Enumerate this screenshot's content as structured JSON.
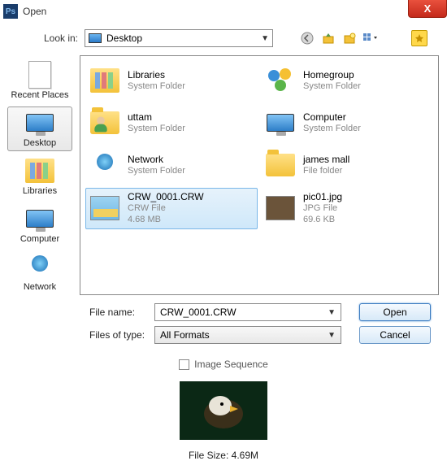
{
  "title": "Open",
  "close_label": "X",
  "lookin": {
    "label": "Look in:",
    "value": "Desktop"
  },
  "nav": {
    "back": "back-icon",
    "up": "up-icon",
    "newfolder": "new-folder-icon",
    "view": "view-menu-icon",
    "favorites": "favorites-icon"
  },
  "places": [
    {
      "label": "Recent Places",
      "icon": "recent-places-icon"
    },
    {
      "label": "Desktop",
      "icon": "desktop-icon",
      "selected": true
    },
    {
      "label": "Libraries",
      "icon": "libraries-icon"
    },
    {
      "label": "Computer",
      "icon": "computer-icon"
    },
    {
      "label": "Network",
      "icon": "network-icon"
    }
  ],
  "files": [
    {
      "name": "Libraries",
      "meta1": "System Folder",
      "meta2": "",
      "icon": "libraries"
    },
    {
      "name": "Homegroup",
      "meta1": "System Folder",
      "meta2": "",
      "icon": "homegroup"
    },
    {
      "name": "uttam",
      "meta1": "System Folder",
      "meta2": "",
      "icon": "user"
    },
    {
      "name": "Computer",
      "meta1": "System Folder",
      "meta2": "",
      "icon": "computer"
    },
    {
      "name": "Network",
      "meta1": "System Folder",
      "meta2": "",
      "icon": "network"
    },
    {
      "name": "james mall",
      "meta1": "File folder",
      "meta2": "",
      "icon": "folder"
    },
    {
      "name": "CRW_0001.CRW",
      "meta1": "CRW File",
      "meta2": "4.68 MB",
      "icon": "image",
      "selected": true
    },
    {
      "name": "pic01.jpg",
      "meta1": "JPG File",
      "meta2": "69.6 KB",
      "icon": "photo"
    }
  ],
  "filename": {
    "label": "File name:",
    "value": "CRW_0001.CRW"
  },
  "filetype": {
    "label": "Files of type:",
    "value": "All Formats"
  },
  "buttons": {
    "open": "Open",
    "cancel": "Cancel"
  },
  "image_sequence": "Image Sequence",
  "file_size": "File Size: 4.69M"
}
